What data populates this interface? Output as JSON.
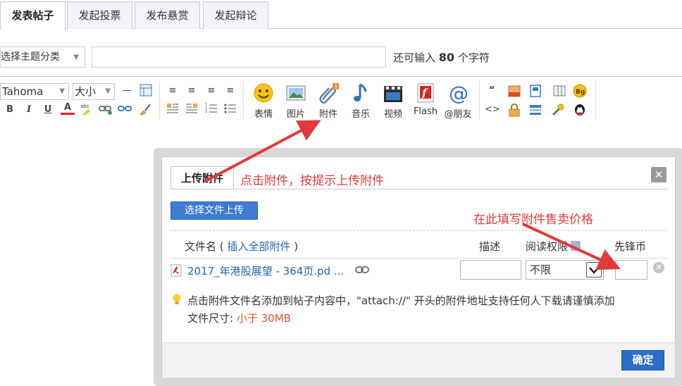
{
  "tabs": [
    {
      "label": "发表帖子",
      "active": true
    },
    {
      "label": "发起投票",
      "active": false
    },
    {
      "label": "发布悬赏",
      "active": false
    },
    {
      "label": "发起辩论",
      "active": false
    }
  ],
  "subject": {
    "category_label": "选择主题分类",
    "subject_value": "",
    "char_prefix": "还可输入",
    "char_count": "80",
    "char_suffix": "个字符"
  },
  "toolbar": {
    "font_family": "Tahoma",
    "font_size": "大小",
    "emoji_label": "表情",
    "image_label": "图片",
    "attach_label": "附件",
    "music_label": "音乐",
    "video_label": "视频",
    "flash_label": "Flash",
    "mention_label": "@朋友"
  },
  "dialog": {
    "tab_label": "上传附件",
    "upload_button": "选择文件上传",
    "col_filename_prefix": "文件名 (",
    "col_insert_all": "插入全部附件",
    "col_filename_suffix": ")",
    "col_desc": "描述",
    "col_perm": "阅读权限",
    "col_price": "先锋币",
    "file": {
      "name": "2017_年港股展望 - 364页.pd ...",
      "desc": "",
      "perm": "不限",
      "price": ""
    },
    "tip": "点击附件文件名添加到帖子内容中，\"attach://\" 开头的附件地址支持任何人下载请谨慎添加",
    "size_label": "文件尺寸:",
    "size_value": "小于 30MB",
    "ok_button": "确定"
  },
  "annotations": {
    "attach_hint": "点击附件，按提示上传附件",
    "price_hint": "在此填写附件售卖价格",
    "color": "#e23a3a"
  }
}
